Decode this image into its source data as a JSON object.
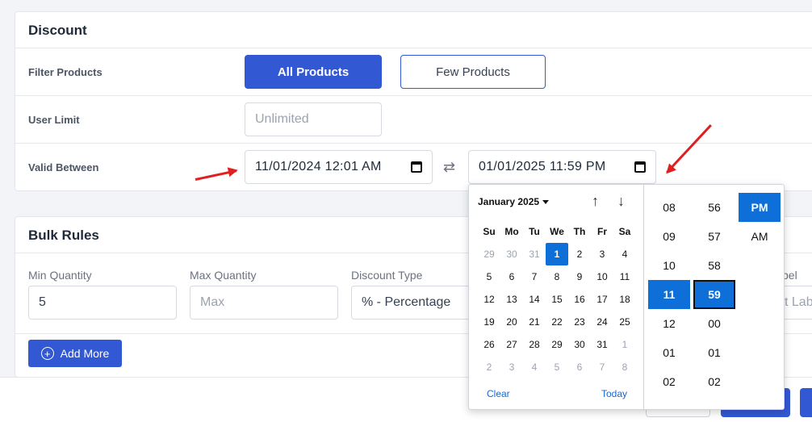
{
  "discount": {
    "title": "Discount",
    "filter_label": "Filter Products",
    "all_products": "All Products",
    "few_products": "Few Products",
    "user_limit_label": "User Limit",
    "user_limit_placeholder": "Unlimited",
    "valid_between_label": "Valid Between",
    "start_datetime": "11/01/2024 12:01 AM",
    "end_datetime": "01/01/2025 11:59 PM"
  },
  "bulk": {
    "title": "Bulk Rules",
    "min_qty_label": "Min Quantity",
    "min_qty_value": "5",
    "max_qty_label": "Max Quantity",
    "max_qty_placeholder": "Max",
    "type_label": "Discount Type",
    "type_value": "% - Percentage",
    "label_partial": "bel",
    "label_placeholder_partial": "t Labe",
    "add_more": "Add More"
  },
  "picker": {
    "month": "January 2025",
    "weekdays": [
      "Su",
      "Mo",
      "Tu",
      "We",
      "Th",
      "Fr",
      "Sa"
    ],
    "weeks": [
      [
        "29",
        "30",
        "31",
        "1",
        "2",
        "3",
        "4"
      ],
      [
        "5",
        "6",
        "7",
        "8",
        "9",
        "10",
        "11"
      ],
      [
        "12",
        "13",
        "14",
        "15",
        "16",
        "17",
        "18"
      ],
      [
        "19",
        "20",
        "21",
        "22",
        "23",
        "24",
        "25"
      ],
      [
        "26",
        "27",
        "28",
        "29",
        "30",
        "31",
        "1"
      ],
      [
        "2",
        "3",
        "4",
        "5",
        "6",
        "7",
        "8"
      ]
    ],
    "clear": "Clear",
    "today": "Today",
    "hours": [
      "08",
      "09",
      "10",
      "11",
      "12",
      "01",
      "02"
    ],
    "minutes": [
      "56",
      "57",
      "58",
      "59",
      "00",
      "01",
      "02"
    ],
    "ampm": [
      "PM",
      "AM"
    ],
    "selected_hour": "11",
    "selected_minute": "59",
    "selected_ampm": "PM",
    "selected_day": "1"
  },
  "colors": {
    "primary": "#3358d4",
    "picker_selected": "#0f6fd8",
    "annotation_arrow": "#e02020"
  }
}
